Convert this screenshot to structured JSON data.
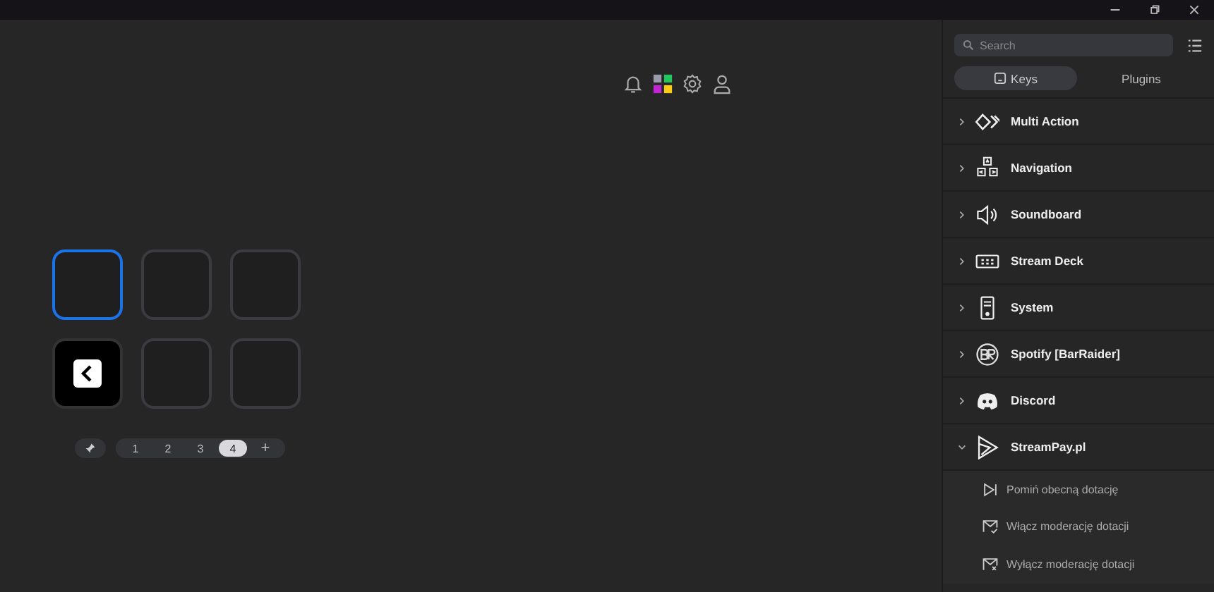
{
  "toolbar": {
    "icons": [
      {
        "kind": "bell"
      },
      {
        "kind": "profile-app"
      },
      {
        "kind": "settings"
      },
      {
        "kind": "account"
      }
    ]
  },
  "keys": [
    {
      "kind": "empty",
      "selected": true
    },
    {
      "kind": "empty",
      "selected": false
    },
    {
      "kind": "empty",
      "selected": false
    },
    {
      "kind": "back",
      "selected": false
    },
    {
      "kind": "empty",
      "selected": false
    },
    {
      "kind": "empty",
      "selected": false
    }
  ],
  "pager": {
    "pages": [
      {
        "label": "1",
        "selected": false
      },
      {
        "label": "2",
        "selected": false
      },
      {
        "label": "3",
        "selected": false
      },
      {
        "label": "4",
        "selected": true
      }
    ],
    "add": "+"
  },
  "search": {
    "placeholder": "Search"
  },
  "tabs": [
    {
      "label": "Keys",
      "selected": true
    },
    {
      "label": "Plugins",
      "selected": false
    }
  ],
  "categories": [
    {
      "kind": "multi",
      "label": "Multi Action",
      "expanded": false
    },
    {
      "kind": "navigation",
      "label": "Navigation",
      "expanded": false
    },
    {
      "kind": "sound",
      "label": "Soundboard",
      "expanded": false
    },
    {
      "kind": "deck",
      "label": "Stream Deck",
      "expanded": false
    },
    {
      "kind": "system",
      "label": "System",
      "expanded": false
    },
    {
      "kind": "br",
      "label": "Spotify [BarRaider]",
      "expanded": false
    },
    {
      "kind": "discord",
      "label": "Discord",
      "expanded": false
    },
    {
      "kind": "streampay",
      "label": "StreamPay.pl",
      "expanded": true,
      "children": [
        {
          "kind": "skip",
          "label": "Pomiń obecną dotację"
        },
        {
          "kind": "mail-on",
          "label": "Włącz moderację dotacji"
        },
        {
          "kind": "mail-off",
          "label": "Wyłącz moderację dotacji"
        }
      ]
    }
  ]
}
